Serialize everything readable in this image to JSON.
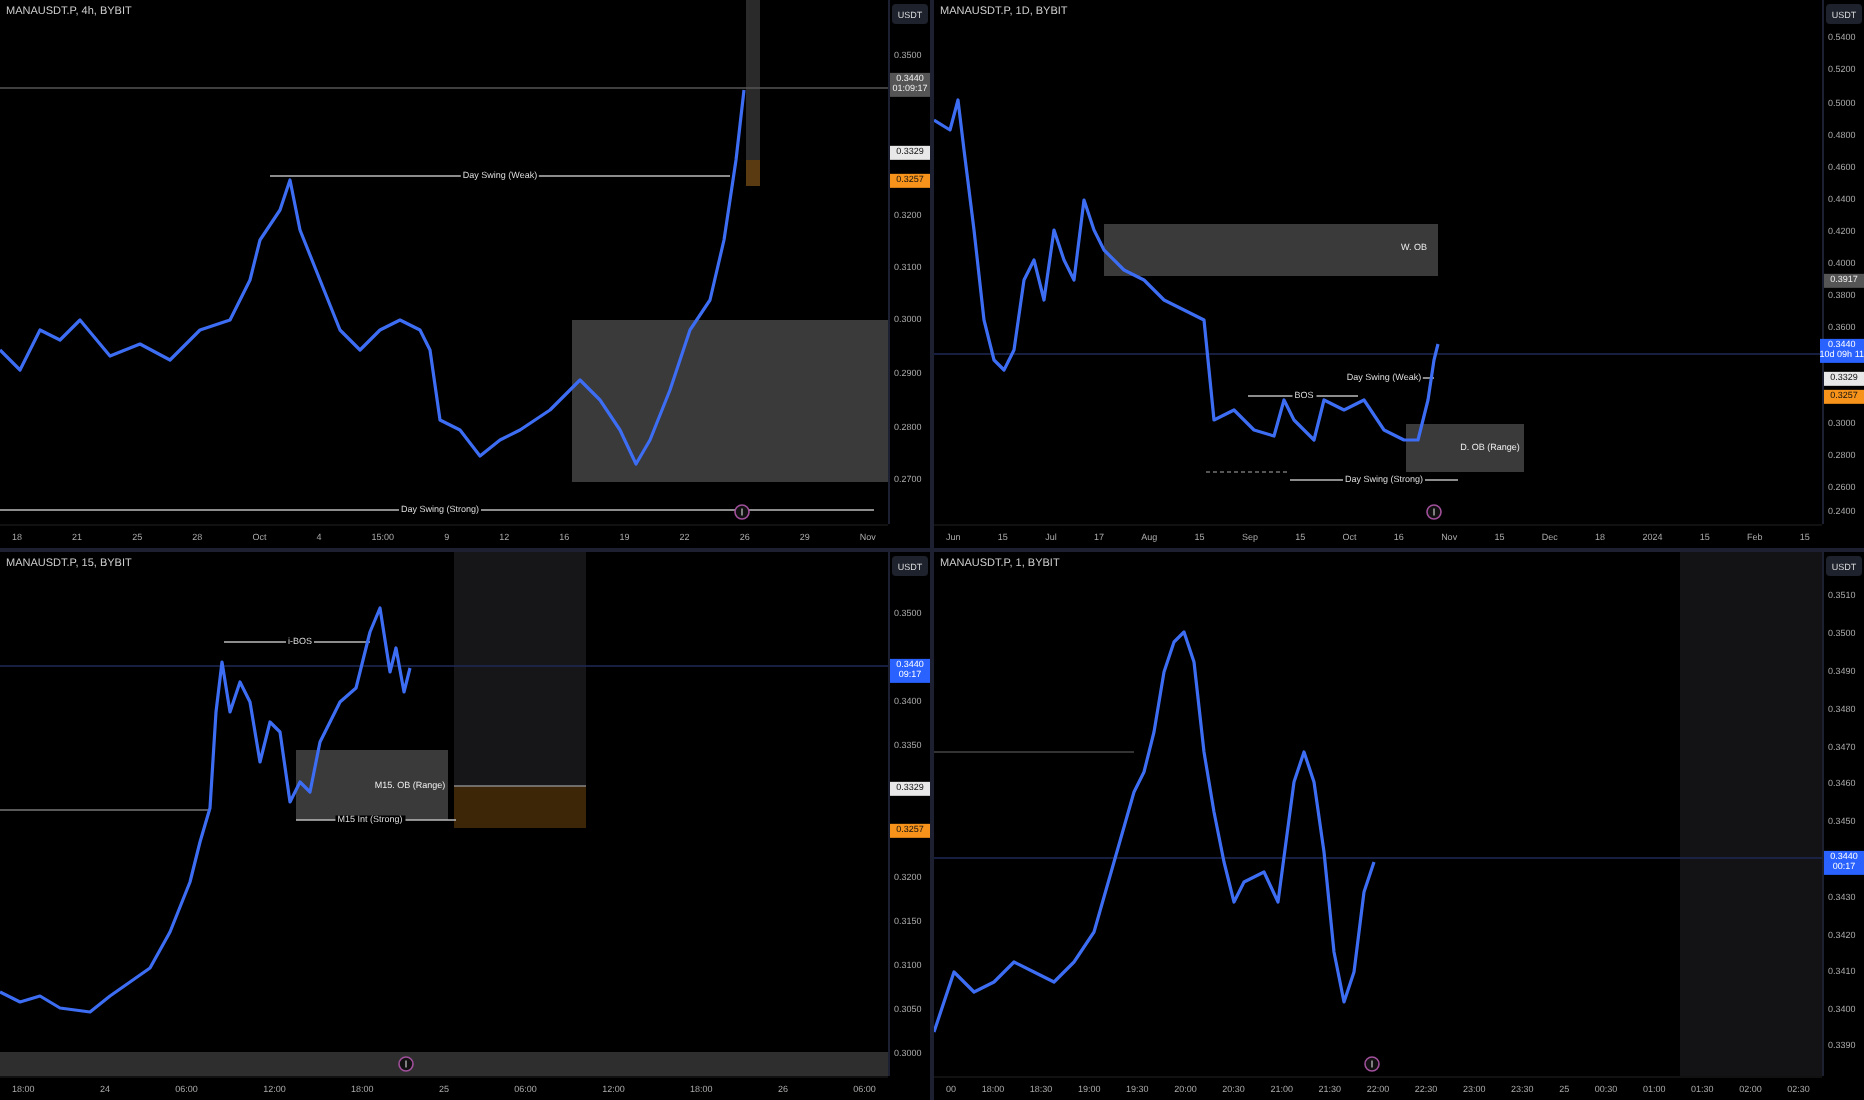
{
  "panes": [
    {
      "legend": "MANAUSDT.P, 4h, BYBIT",
      "currency": "USDT",
      "price_ticks": [
        "0.3500",
        "0.3200",
        "0.3100",
        "0.3000",
        "0.2900",
        "0.2800",
        "0.2700"
      ],
      "price_labels": [
        {
          "kind": "grey",
          "value": "0.3440",
          "sub": "01:09:17"
        },
        {
          "kind": "white",
          "value": "0.3329"
        },
        {
          "kind": "orange",
          "value": "0.3257"
        }
      ],
      "annotations": [
        {
          "kind": "line",
          "label": "Day Swing (Weak)"
        },
        {
          "kind": "line",
          "label": "Day Swing (Strong)"
        }
      ],
      "time_ticks": [
        "18",
        "21",
        "25",
        "28",
        "Oct",
        "4",
        "15:00",
        "9",
        "12",
        "16",
        "19",
        "22",
        "26",
        "29",
        "Nov"
      ]
    },
    {
      "legend": "MANAUSDT.P, 1D, BYBIT",
      "currency": "USDT",
      "price_ticks": [
        "0.5400",
        "0.5200",
        "0.5000",
        "0.4800",
        "0.4600",
        "0.4400",
        "0.4200",
        "0.4000",
        "0.3800",
        "0.3600",
        "0.3000",
        "0.2800",
        "0.2600",
        "0.2400"
      ],
      "price_labels": [
        {
          "kind": "grey",
          "value": "0.3917"
        },
        {
          "kind": "last",
          "value": "0.3440",
          "sub": "10d 09h 11"
        },
        {
          "kind": "white",
          "value": "0.3329"
        },
        {
          "kind": "orange",
          "value": "0.3257"
        }
      ],
      "annotations": [
        {
          "kind": "zone",
          "label": "W. OB"
        },
        {
          "kind": "line",
          "label": "BOS"
        },
        {
          "kind": "line",
          "label": "Day Swing (Weak)"
        },
        {
          "kind": "zone",
          "label": "D. OB (Range)"
        },
        {
          "kind": "line",
          "label": "Day Swing (Strong)"
        }
      ],
      "time_ticks": [
        "Jun",
        "15",
        "Jul",
        "17",
        "Aug",
        "15",
        "Sep",
        "15",
        "Oct",
        "16",
        "Nov",
        "15",
        "Dec",
        "18",
        "2024",
        "15",
        "Feb",
        "15"
      ]
    },
    {
      "legend": "MANAUSDT.P, 15, BYBIT",
      "currency": "USDT",
      "price_ticks": [
        "0.3500",
        "0.3400",
        "0.3350",
        "0.3200",
        "0.3150",
        "0.3100",
        "0.3050",
        "0.3000"
      ],
      "price_labels": [
        {
          "kind": "last",
          "value": "0.3440",
          "sub": "09:17"
        },
        {
          "kind": "white",
          "value": "0.3329"
        },
        {
          "kind": "orange",
          "value": "0.3257"
        }
      ],
      "annotations": [
        {
          "kind": "line",
          "label": "i-BOS"
        },
        {
          "kind": "zone",
          "label": "M15. OB (Range)"
        },
        {
          "kind": "line",
          "label": "M15 Int (Strong)"
        }
      ],
      "time_ticks": [
        "18:00",
        "24",
        "06:00",
        "12:00",
        "18:00",
        "25",
        "06:00",
        "12:00",
        "18:00",
        "26",
        "06:00"
      ]
    },
    {
      "legend": "MANAUSDT.P, 1, BYBIT",
      "currency": "USDT",
      "price_ticks": [
        "0.3510",
        "0.3500",
        "0.3490",
        "0.3480",
        "0.3470",
        "0.3460",
        "0.3450",
        "0.3430",
        "0.3420",
        "0.3410",
        "0.3400",
        "0.3390"
      ],
      "price_labels": [
        {
          "kind": "last",
          "value": "0.3440",
          "sub": "00:17"
        }
      ],
      "time_ticks": [
        "00",
        "18:00",
        "18:30",
        "19:00",
        "19:30",
        "20:00",
        "20:30",
        "21:00",
        "21:30",
        "22:00",
        "22:30",
        "23:00",
        "23:30",
        "25",
        "00:30",
        "01:00",
        "01:30",
        "02:00",
        "02:30"
      ]
    }
  ]
}
